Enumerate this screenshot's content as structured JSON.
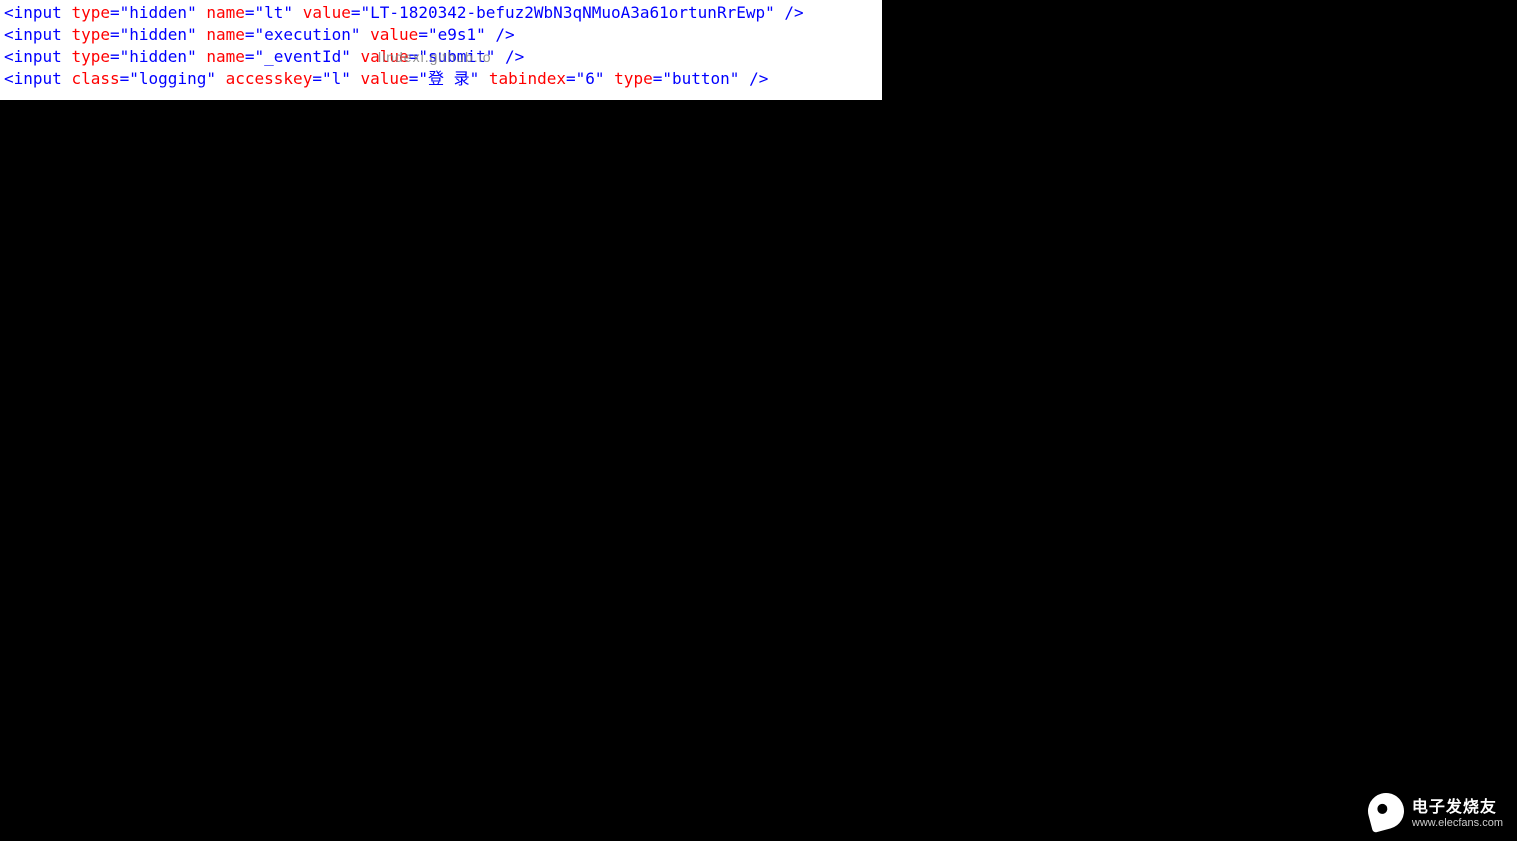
{
  "code": {
    "lines": [
      {
        "tag": "input",
        "attrs": [
          {
            "name": "type",
            "value": "hidden"
          },
          {
            "name": "name",
            "value": "lt"
          },
          {
            "name": "value",
            "value": "LT-1820342-befuz2WbN3qNMuoA3a61ortunRrEwp"
          }
        ]
      },
      {
        "tag": "input",
        "attrs": [
          {
            "name": "type",
            "value": "hidden"
          },
          {
            "name": "name",
            "value": "execution"
          },
          {
            "name": "value",
            "value": "e9s1"
          }
        ]
      },
      {
        "tag": "input",
        "attrs": [
          {
            "name": "type",
            "value": "hidden"
          },
          {
            "name": "name",
            "value": "_eventId"
          },
          {
            "name": "value",
            "value": "submit"
          }
        ]
      },
      {
        "tag": "input",
        "attrs": [
          {
            "name": "class",
            "value": "logging"
          },
          {
            "name": "accesskey",
            "value": "l"
          },
          {
            "name": "value",
            "value": "登 录"
          },
          {
            "name": "tabindex",
            "value": "6"
          },
          {
            "name": "type",
            "value": "button"
          }
        ]
      }
    ]
  },
  "watermark": "lindexi.github.io",
  "footer": {
    "brand_cn": "电子发烧友",
    "brand_url": "www.elecfans.com"
  }
}
